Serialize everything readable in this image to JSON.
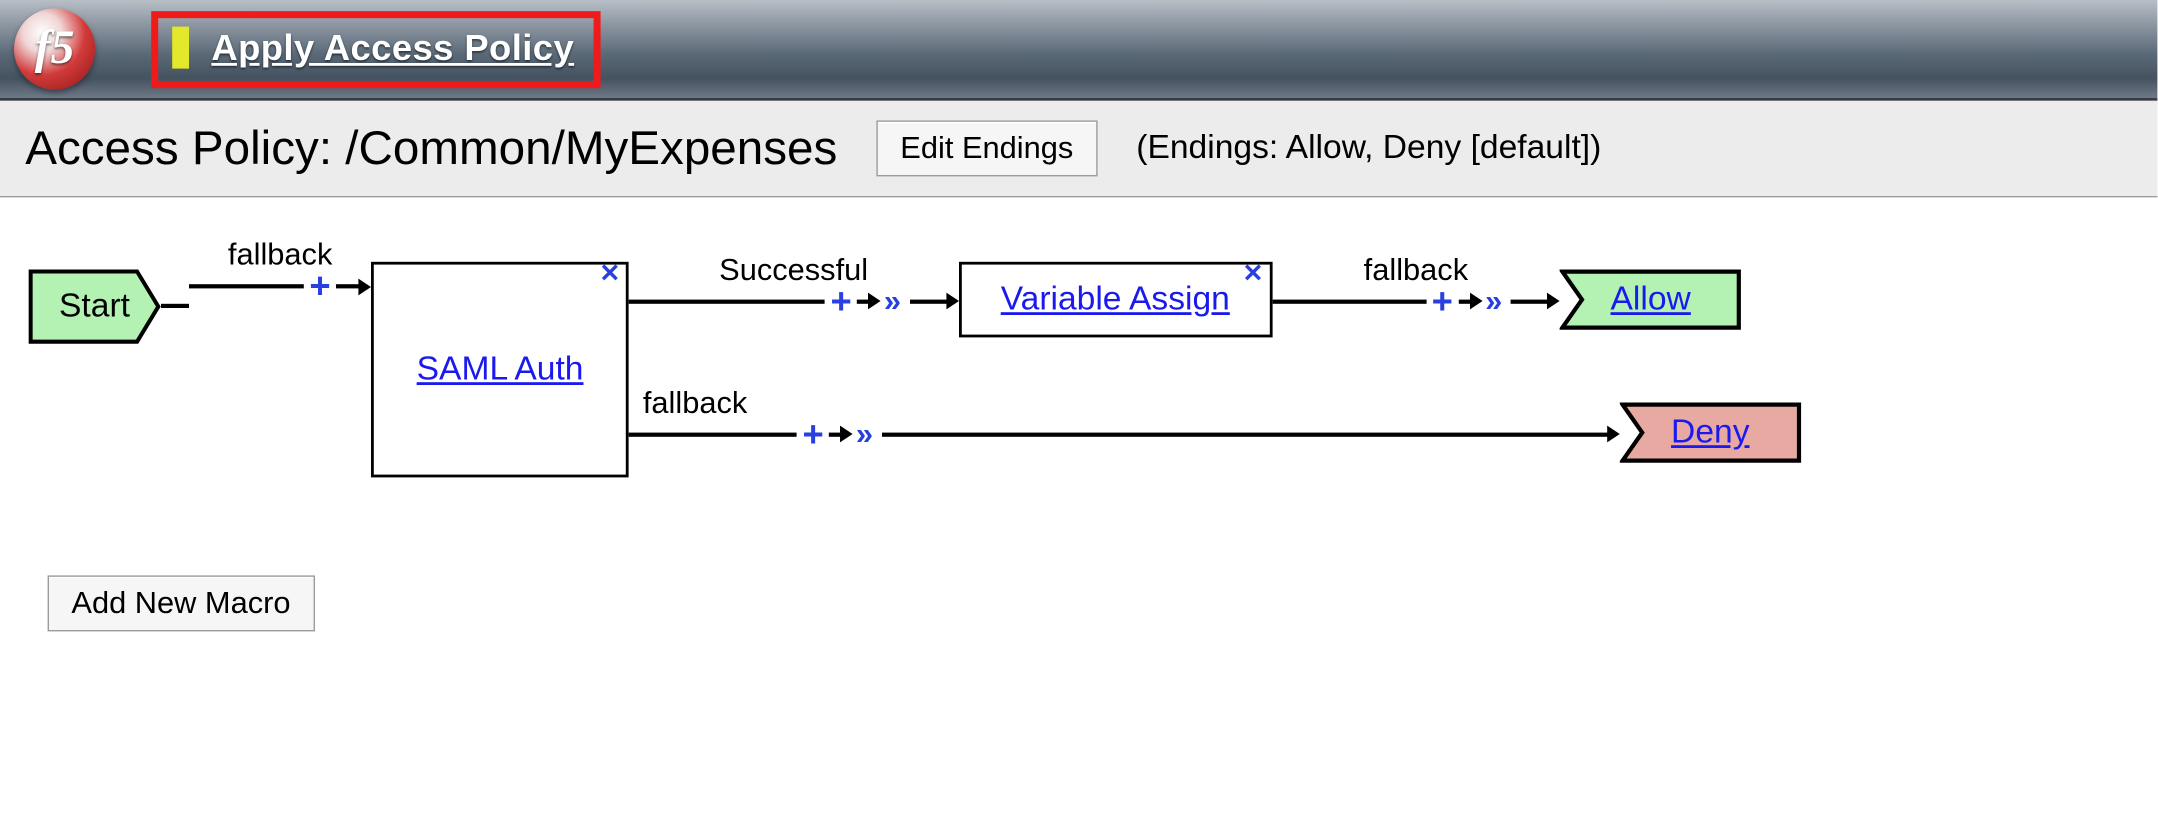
{
  "logo_text": "f5",
  "header": {
    "apply_link": "Apply Access Policy"
  },
  "subheader": {
    "title": "Access Policy: /Common/MyExpenses",
    "edit_endings_btn": "Edit Endings",
    "endings_summary": "(Endings: Allow, Deny [default])"
  },
  "flow": {
    "start": "Start",
    "branch_start": "fallback",
    "saml_box": "SAML Auth",
    "branch_success": "Successful",
    "branch_saml_fallback": "fallback",
    "var_assign_box": "Variable Assign",
    "branch_var_fallback": "fallback",
    "ending_allow": "Allow",
    "ending_deny": "Deny"
  },
  "buttons": {
    "add_macro": "Add New Macro"
  },
  "glyphs": {
    "plus": "+",
    "close": "✕",
    "dbl_arrow": "»"
  },
  "colors": {
    "start_fill": "#b4f2b4",
    "allow_fill": "#b4f2b4",
    "deny_fill": "#e8a9a3",
    "highlight_border": "#ef1a1a"
  }
}
